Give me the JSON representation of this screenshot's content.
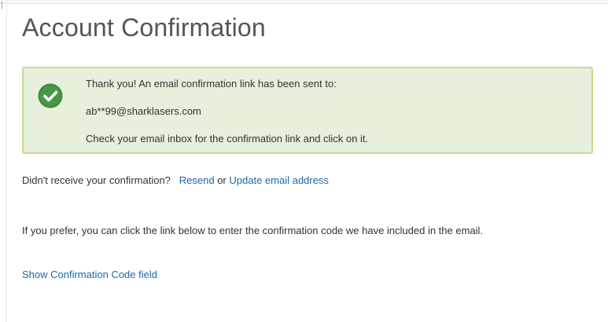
{
  "page": {
    "title": "Account Confirmation"
  },
  "confirmation_box": {
    "line1": "Thank you! An email confirmation link has been sent to:",
    "email": "ab**99@sharklasers.com",
    "line3": "Check your email inbox for the confirmation link and click on it.",
    "icon": "check-circle-icon",
    "colors": {
      "background": "#e7efdd",
      "border": "#c9d98f",
      "icon": "#3d8b3d"
    }
  },
  "resend": {
    "prompt": "Didn't receive your confirmation?",
    "resend_link": "Resend",
    "or_text": "or",
    "update_link": "Update email address"
  },
  "code_section": {
    "prefer_text": "If you prefer, you can click the link below to enter the confirmation code we have included in the email.",
    "show_link": "Show Confirmation Code field"
  },
  "colors": {
    "link": "#1f66a8",
    "title": "#555555"
  }
}
